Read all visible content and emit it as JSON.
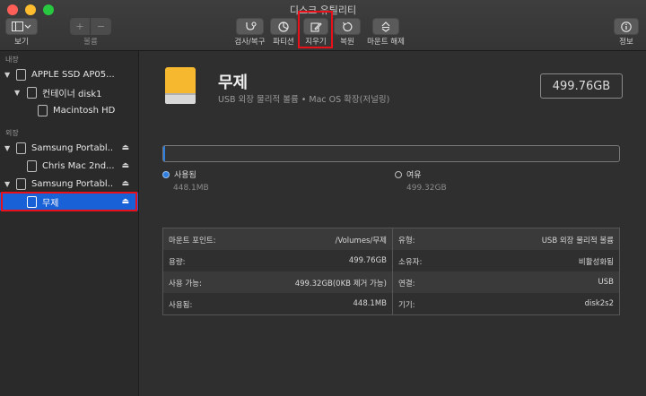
{
  "window": {
    "title": "디스크 유틸리티"
  },
  "toolbar": {
    "view_label": "보기",
    "volume_label": "볼륨",
    "firstaid_label": "검사/복구",
    "partition_label": "파티션",
    "erase_label": "지우기",
    "restore_label": "복원",
    "unmount_label": "마운트 해제",
    "info_label": "정보",
    "add_glyph": "+",
    "remove_glyph": "−"
  },
  "sidebar": {
    "internal_label": "내장",
    "external_label": "외장",
    "items": [
      {
        "label": "APPLE SSD AP05..."
      },
      {
        "label": "컨테이너 disk1"
      },
      {
        "label": "Macintosh HD"
      },
      {
        "label": "Samsung Portabl..."
      },
      {
        "label": "Chris Mac 2nd..."
      },
      {
        "label": "Samsung Portabl..."
      },
      {
        "label": "무제"
      }
    ]
  },
  "volume": {
    "name": "무제",
    "subtitle": "USB 외장 물리적 볼륨 • Mac OS 확장(저널링)",
    "capacity": "499.76GB",
    "used_fraction": 0.0009
  },
  "usage": {
    "used_label": "사용됨",
    "used_value": "448.1MB",
    "free_label": "여유",
    "free_value": "499.32GB"
  },
  "info": {
    "left": [
      {
        "k": "마운트 포인트:",
        "v": "/Volumes/무제"
      },
      {
        "k": "용량:",
        "v": "499.76GB"
      },
      {
        "k": "사용 가능:",
        "v": "499.32GB(0KB 제거 가능)"
      },
      {
        "k": "사용됨:",
        "v": "448.1MB"
      }
    ],
    "right": [
      {
        "k": "유형:",
        "v": "USB 외장 물리적 볼륨"
      },
      {
        "k": "소유자:",
        "v": "비활성화됨"
      },
      {
        "k": "연결:",
        "v": "USB"
      },
      {
        "k": "기기:",
        "v": "disk2s2"
      }
    ]
  },
  "colors": {
    "accent": "#1961d6",
    "highlight": "#e8101a",
    "used": "#2f7fe0"
  }
}
